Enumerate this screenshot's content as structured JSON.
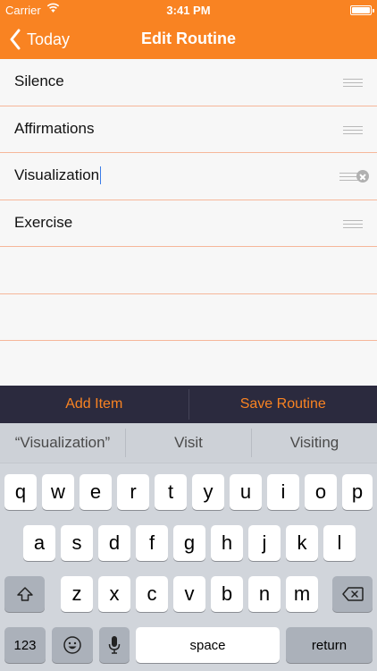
{
  "status_bar": {
    "carrier": "Carrier",
    "time": "3:41 PM"
  },
  "nav": {
    "back_label": "Today",
    "title": "Edit Routine"
  },
  "routine_items": [
    "Silence",
    "Affirmations",
    "Visualization",
    "Exercise"
  ],
  "actions": {
    "add_item": "Add Item",
    "save_routine": "Save Routine"
  },
  "keyboard": {
    "suggestions": [
      "“Visualization”",
      "Visit",
      "Visiting"
    ],
    "rows": [
      [
        "q",
        "w",
        "e",
        "r",
        "t",
        "y",
        "u",
        "i",
        "o",
        "p"
      ],
      [
        "a",
        "s",
        "d",
        "f",
        "g",
        "h",
        "j",
        "k",
        "l"
      ],
      [
        "z",
        "x",
        "c",
        "v",
        "b",
        "n",
        "m"
      ]
    ],
    "numbers_key": "123",
    "space_key": "space",
    "return_key": "return"
  },
  "colors": {
    "accent": "#f98322",
    "action_bar": "#2b2a3e",
    "row_divider": "#f6b79a"
  }
}
